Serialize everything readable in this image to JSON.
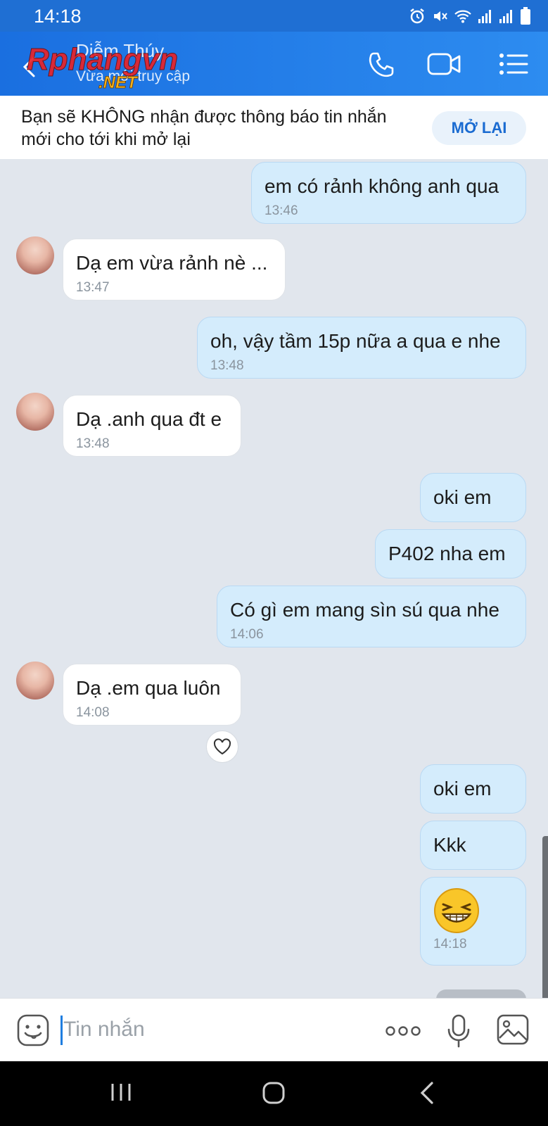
{
  "status_bar": {
    "time": "14:18"
  },
  "header": {
    "contact_name": "Diễm Thúy",
    "contact_status": "Vừa mới truy cập",
    "watermark_text": "Rphangvn",
    "watermark_sub": ".NET",
    "icons": [
      "back-icon",
      "phone-icon",
      "video-call-icon",
      "menu-list-icon"
    ]
  },
  "mute_banner": {
    "text": "Bạn sẽ KHÔNG nhận được thông báo tin nhắn mới cho tới khi mở lại",
    "button_label": "MỞ LẠI"
  },
  "messages": [
    {
      "direction": "out",
      "text": "em có rảnh không anh qua",
      "time": "13:46"
    },
    {
      "direction": "in",
      "text": "Dạ em vừa rảnh nè ...",
      "time": "13:47"
    },
    {
      "direction": "out",
      "text": "oh, vậy tầm 15p nữa a qua e nhe",
      "time": "13:48"
    },
    {
      "direction": "in",
      "text": "Dạ .anh qua đt e",
      "time": "13:48"
    },
    {
      "direction": "out",
      "text": "oki em",
      "time": ""
    },
    {
      "direction": "out",
      "text": "P402 nha em",
      "time": ""
    },
    {
      "direction": "out",
      "text": "Có gì em mang sìn sú qua nhe",
      "time": "14:06"
    },
    {
      "direction": "in",
      "text": "Dạ .em qua luôn",
      "time": "14:08"
    },
    {
      "direction": "out",
      "text": "oki em",
      "time": ""
    },
    {
      "direction": "out",
      "text": "Kkk",
      "time": ""
    },
    {
      "direction": "out",
      "text": "",
      "emoji": "grinning-squint-emoji",
      "time": "14:18"
    }
  ],
  "input_bar": {
    "placeholder": "Tin nhắn",
    "icons": [
      "sticker-icon",
      "more-options-icon",
      "microphone-icon",
      "image-icon"
    ]
  },
  "nav_bar": {
    "icons": [
      "recent-apps-icon",
      "home-icon",
      "back-nav-icon"
    ]
  },
  "colors": {
    "header": "#1a6fe0",
    "outgoing_bubble": "#d4ecfc",
    "incoming_bubble": "#ffffff",
    "chat_background": "#e1e6ed",
    "accent": "#1a6bd1"
  }
}
